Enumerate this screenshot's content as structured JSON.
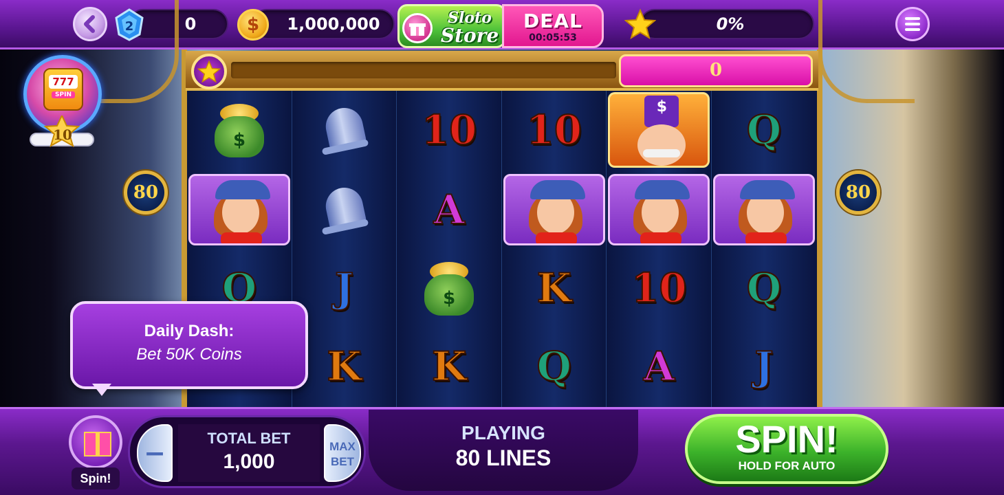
{
  "header": {
    "gems": "0",
    "coins": "1,000,000",
    "store": {
      "line1": "Sloto",
      "line2": "Store"
    },
    "deal": {
      "title": "DEAL",
      "timer": "00:05:53"
    },
    "progress": "0%"
  },
  "sidebar": {
    "level": "10",
    "machine_reels": "777",
    "machine_spin": "SPIN",
    "lines_left": "80",
    "lines_right": "80"
  },
  "jackpot_meter": {
    "value": "0"
  },
  "reels": [
    [
      "bag",
      "girl",
      "Q",
      "blank"
    ],
    [
      "bell",
      "bell",
      "J",
      "K"
    ],
    [
      "10",
      "A",
      "bag",
      "K"
    ],
    [
      "10",
      "girl",
      "K",
      "Q"
    ],
    [
      "boss",
      "girl",
      "10",
      "A"
    ],
    [
      "Q",
      "girl",
      "Q",
      "J"
    ]
  ],
  "tooltip": {
    "title": "Daily Dash:",
    "text": "Bet 50K Coins"
  },
  "bottom": {
    "gift_label": "Spin!",
    "bet_minus": "−",
    "total_bet_label": "TOTAL BET",
    "total_bet_value": "1,000",
    "max_bet_line1": "MAX",
    "max_bet_line2": "BET",
    "playing_label": "PLAYING",
    "lines_value": "80 LINES",
    "spin_label": "SPIN!",
    "spin_sub": "HOLD FOR AUTO"
  },
  "colors": {
    "accent": "#8a2cc8",
    "spin": "#3cb22a",
    "deal": "#e2178f"
  }
}
